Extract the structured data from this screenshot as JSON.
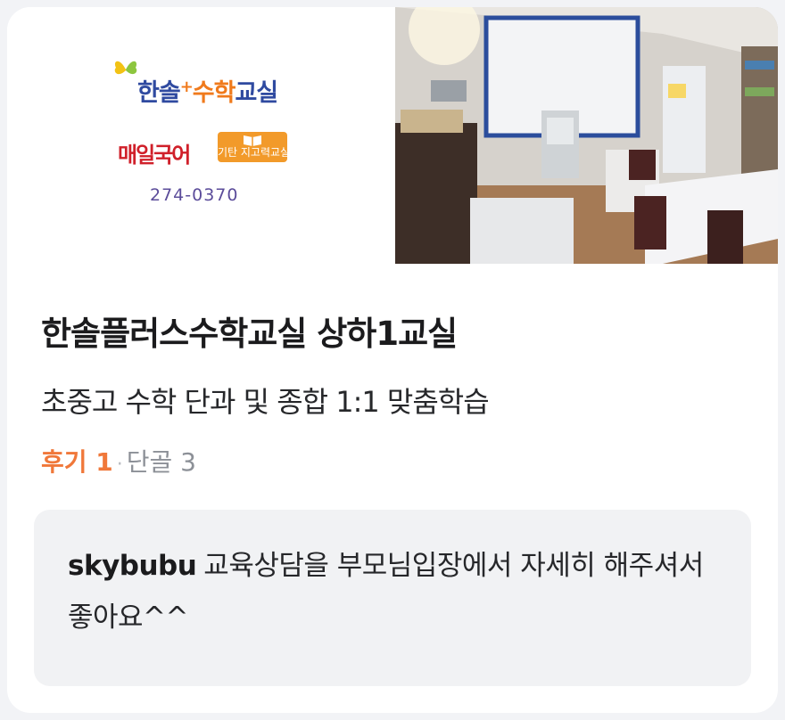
{
  "listing": {
    "logo": {
      "brand_text_main": "한솔",
      "brand_plus": "+",
      "brand_text_accent": "수학",
      "brand_text_tail": "교실",
      "sub_brand_1": "매일국어",
      "sub_brand_2": "기탄 지고력교실",
      "phone": "274-0370"
    },
    "title": "한솔플러스수학교실 상하1교실",
    "description": "초중고 수학 단과 및 종합 1:1 맞춤학습",
    "reviews_label": "후기 1",
    "separator": "·",
    "regulars_label": "단골 3",
    "review": {
      "author": "skybubu",
      "text": "교육상담을 부모님입장에서 자세히 해주셔서 좋아요^^"
    }
  },
  "colors": {
    "accent": "#f0783a",
    "muted": "#8c9097",
    "review_bg": "#f1f2f4"
  }
}
